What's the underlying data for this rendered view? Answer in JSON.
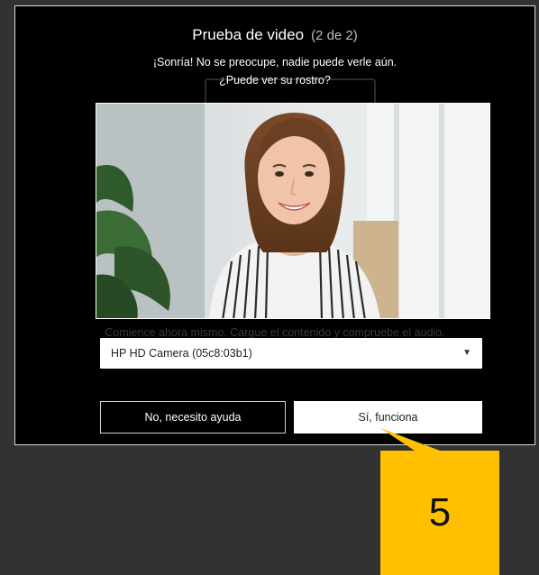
{
  "dialog": {
    "title": "Prueba de video",
    "step": "(2 de 2)",
    "subtitle": "¡Sonría! No se preocupe, nadie puede verle aún.",
    "question": "¿Puede ver su rostro?",
    "ghost_text": "Comience ahora mismo. Cargue el contenido y compruebe el audio."
  },
  "camera_select": {
    "selected": "HP HD Camera (05c8:03b1)"
  },
  "buttons": {
    "no_label": "No, necesito ayuda",
    "yes_label": "Sí, funciona"
  },
  "callout": {
    "number": "5",
    "color": "#ffc000"
  },
  "icons": {
    "dropdown": "caret-down-icon"
  }
}
